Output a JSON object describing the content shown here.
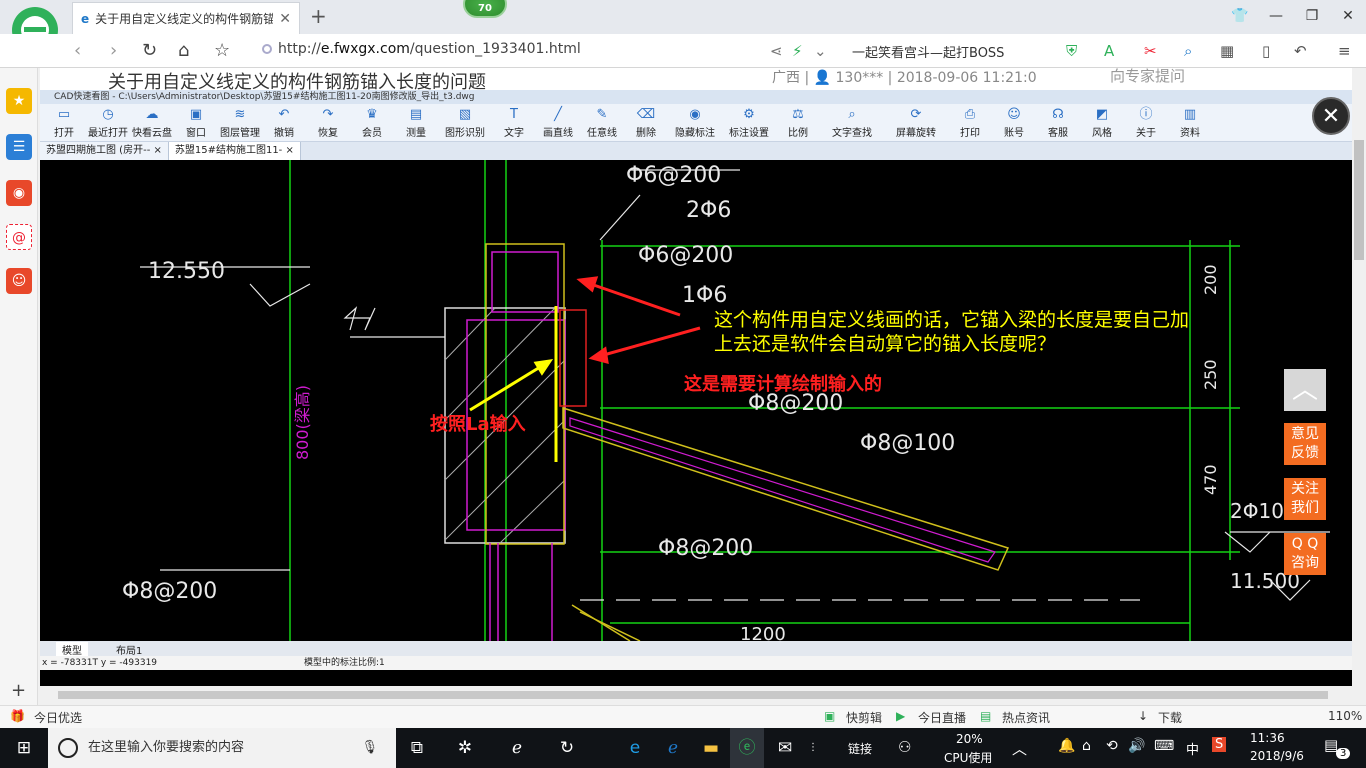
{
  "browser": {
    "tab_title": "关于用自定义线定义的构件钢筋锚",
    "score_badge": "70",
    "url_prefix": "http://",
    "url_host": "e.fwxgx.com",
    "url_path": "/question_1933401.html",
    "news_ticker": "一起笑看宫斗—起打BOSS"
  },
  "page": {
    "title": "关于用自定义线定义的构件钢筋锚入长度的问题",
    "meta": "广西 | 👤 130*** | 2018-09-06 11:21:0",
    "ask_expert": "向专家提问"
  },
  "cad": {
    "window_title": "CAD快速看图 - C:\\Users\\Administrator\\Desktop\\苏盟15#结构施工图11-20南图修改版_导出_t3.dwg",
    "tools": [
      {
        "label": "打开",
        "icon": "folder-icon"
      },
      {
        "label": "最近打开",
        "icon": "clock-icon"
      },
      {
        "label": "快看云盘",
        "icon": "cloud-icon"
      },
      {
        "label": "窗口",
        "icon": "window-icon"
      },
      {
        "label": "图层管理",
        "icon": "layers-icon"
      },
      {
        "label": "撤销",
        "icon": "undo-icon"
      },
      {
        "label": "恢复",
        "icon": "redo-icon"
      },
      {
        "label": "会员",
        "icon": "vip-icon"
      },
      {
        "label": "测量",
        "icon": "ruler-icon"
      },
      {
        "label": "图形识别",
        "icon": "shape-icon"
      },
      {
        "label": "文字",
        "icon": "text-icon"
      },
      {
        "label": "画直线",
        "icon": "line-icon"
      },
      {
        "label": "任意线",
        "icon": "pen-icon"
      },
      {
        "label": "删除",
        "icon": "eraser-icon"
      },
      {
        "label": "隐藏标注",
        "icon": "eye-icon"
      },
      {
        "label": "标注设置",
        "icon": "settings-icon"
      },
      {
        "label": "比例",
        "icon": "scale-icon"
      },
      {
        "label": "文字查找",
        "icon": "find-icon"
      },
      {
        "label": "屏幕旋转",
        "icon": "rotate-icon"
      },
      {
        "label": "打印",
        "icon": "printer-icon"
      },
      {
        "label": "账号",
        "icon": "user-icon"
      },
      {
        "label": "客服",
        "icon": "headset-icon"
      },
      {
        "label": "风格",
        "icon": "style-icon"
      },
      {
        "label": "关于",
        "icon": "info-icon"
      },
      {
        "label": "资料",
        "icon": "doc-icon"
      }
    ],
    "tabs": [
      "苏盟四期施工图 (房开-- ×",
      "苏盟15#结构施工图11- ×"
    ],
    "drawing": {
      "labels": [
        "Φ6@200",
        "2Φ6",
        "Φ6@200",
        "1Φ6",
        "12.550",
        "800(梁高)",
        "Φ8@200",
        "Φ8@100",
        "Φ8@200",
        "Φ8@200",
        "200",
        "250",
        "470",
        "1200",
        "11.500",
        "2Φ10"
      ],
      "annotation_question": "这个构件用自定义线画的话，它锚入梁的长度是要自己加上去还是软件会自动算它的锚入长度呢？",
      "annotation_line1": "这个构件用自定义线画的话，它锚入梁的长度是要自己加",
      "annotation_line2": "上去还是软件会自动算它的锚入长度呢？",
      "annotation_answer": "这是需要计算绘制输入的",
      "annotation_la": "按照La输入"
    },
    "layout_tabs": [
      "模型",
      "布局1"
    ],
    "coords": "x = -78331T  y = -493319",
    "scale_status": "模型中的标注比例:1"
  },
  "floats": {
    "feedback": [
      "意见",
      "反馈"
    ],
    "follow": [
      "关注",
      "我们"
    ],
    "qq": [
      "Q Q",
      "咨询"
    ]
  },
  "statusbar": {
    "left": "今日优选",
    "items": [
      "快剪辑",
      "今日直播",
      "热点资讯",
      "下载"
    ],
    "zoom": "110%"
  },
  "taskbar": {
    "search_placeholder": "在这里输入你要搜索的内容",
    "link_label": "链接",
    "cpu_pct": "20%",
    "cpu_label": "CPU使用",
    "ime": "中",
    "time": "11:36",
    "date": "2018/9/6",
    "notif_count": "3"
  },
  "colors": {
    "accent": "#f36c21",
    "cad_bg": "#000000",
    "annotation_yellow": "#ffff00",
    "annotation_red": "#ff2020"
  }
}
